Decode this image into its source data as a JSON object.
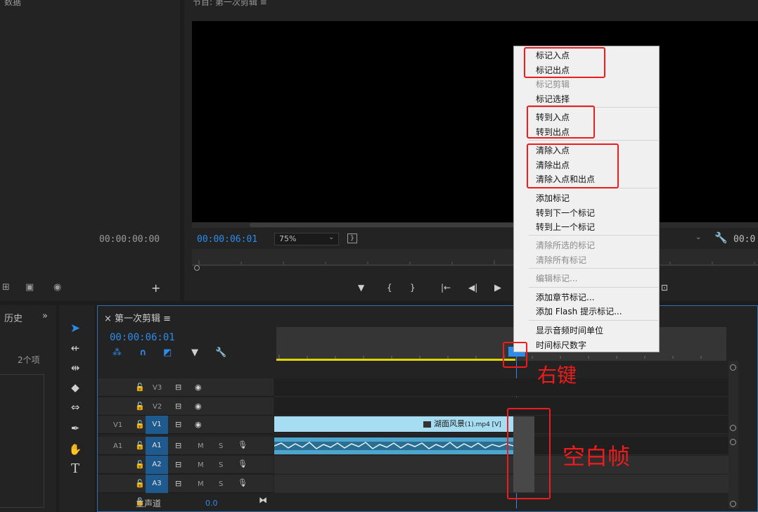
{
  "project_panel": {
    "title": "数据",
    "timecode": "00:00:00:00"
  },
  "program_monitor": {
    "title": "节目: 第一次剪辑 ≡",
    "timecode": "00:00:06:01",
    "zoom": "75%",
    "right_timecode": "00:0"
  },
  "history_panel": {
    "title": "历史",
    "more": "»",
    "items_count": "2个项"
  },
  "timeline": {
    "tab": "× 第一次剪辑 ≡",
    "timecode": "00:00:06:01",
    "tracks": {
      "v3": "V3",
      "v2": "V2",
      "v1_src": "V1",
      "v1": "V1",
      "a1_src": "A1",
      "a1": "A1",
      "a2": "A2",
      "a3": "A3",
      "m": "M",
      "s": "S"
    },
    "v1_clip": {
      "name": "湖面风景",
      "suffix": "(1).mp4 [V]"
    },
    "master": {
      "label": "主声道",
      "value": "0.0"
    }
  },
  "context_menu": {
    "items": [
      {
        "label": "标记入点",
        "enabled": true
      },
      {
        "label": "标记出点",
        "enabled": true
      },
      {
        "label": "标记剪辑",
        "enabled": false
      },
      {
        "label": "标记选择",
        "enabled": true
      },
      {
        "label": "转到入点",
        "enabled": true
      },
      {
        "label": "转到出点",
        "enabled": true
      },
      {
        "label": "清除入点",
        "enabled": true
      },
      {
        "label": "清除出点",
        "enabled": true
      },
      {
        "label": "清除入点和出点",
        "enabled": true
      },
      {
        "label": "添加标记",
        "enabled": true
      },
      {
        "label": "转到下一个标记",
        "enabled": true
      },
      {
        "label": "转到上一个标记",
        "enabled": true
      },
      {
        "label": "清除所选的标记",
        "enabled": false
      },
      {
        "label": "清除所有标记",
        "enabled": false
      },
      {
        "label": "编辑标记...",
        "enabled": false
      },
      {
        "label": "添加章节标记...",
        "enabled": true
      },
      {
        "label": "添加 Flash 提示标记...",
        "enabled": true
      },
      {
        "label": "显示音频时间单位",
        "enabled": true
      },
      {
        "label": "时间标尺数字",
        "enabled": true
      }
    ]
  },
  "annotations": {
    "right_click": "右键",
    "blank_frame": "空白帧"
  },
  "colors": {
    "accent": "#2d8ceb",
    "annotation": "#ee1c1c",
    "in_out_bar": "#e3d400"
  },
  "icons": [
    "wrench-icon",
    "selection-tool-icon",
    "hand-tool-icon",
    "type-tool-icon",
    "pen-tool-icon",
    "razor-tool-icon",
    "lock-icon",
    "eye-icon",
    "mic-icon",
    "snap-icon",
    "marker-icon",
    "play-icon",
    "step-back-icon",
    "go-to-in-icon",
    "mark-in-icon",
    "mark-out-icon"
  ]
}
